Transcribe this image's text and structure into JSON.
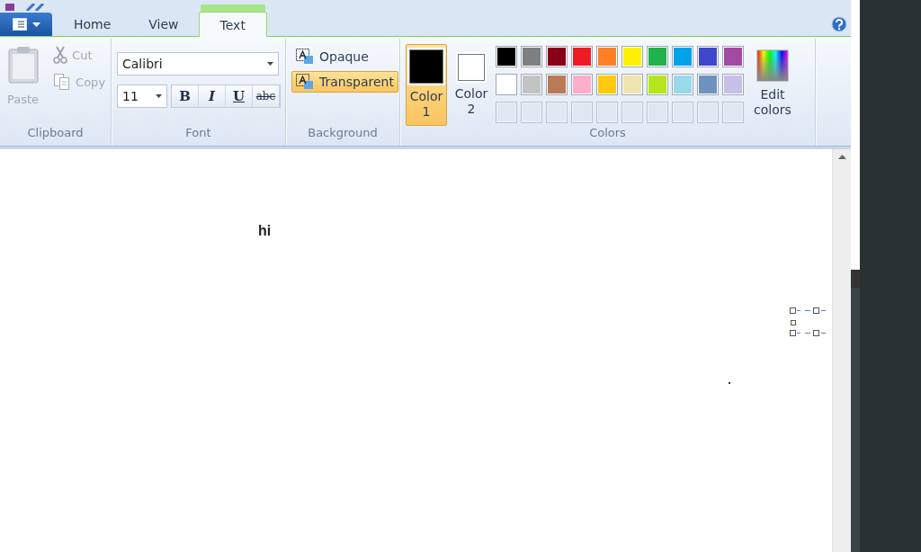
{
  "tabs": [
    {
      "label": "Home",
      "selected": false
    },
    {
      "label": "View",
      "selected": false
    },
    {
      "label": "Text",
      "selected": true
    }
  ],
  "clipboard": {
    "group_label": "Clipboard",
    "paste": {
      "label": "Paste",
      "disabled": true
    },
    "cut": {
      "label": "Cut",
      "disabled": true
    },
    "copy": {
      "label": "Copy",
      "disabled": true
    }
  },
  "font": {
    "group_label": "Font",
    "family": "Calibri",
    "size": "11",
    "styles": [
      {
        "kind": "bold",
        "label": "B"
      },
      {
        "kind": "italic",
        "label": "I"
      },
      {
        "kind": "underline",
        "label": "U"
      },
      {
        "kind": "strikethrough",
        "label": "abc"
      }
    ]
  },
  "background": {
    "group_label": "Background",
    "options": [
      {
        "label": "Opaque",
        "selected": false
      },
      {
        "label": "Transparent",
        "selected": true
      }
    ]
  },
  "colors": {
    "group_label": "Colors",
    "color1": {
      "label": "Color 1",
      "color": "#000000",
      "selected": true
    },
    "color2": {
      "label": "Color 2",
      "color": "#ffffff",
      "selected": false
    },
    "palette": [
      {
        "color": "#000000"
      },
      {
        "color": "#7f7f7f"
      },
      {
        "color": "#880015"
      },
      {
        "color": "#ed1c24"
      },
      {
        "color": "#ff7f27"
      },
      {
        "color": "#fff200"
      },
      {
        "color": "#22b14c"
      },
      {
        "color": "#00a2e8"
      },
      {
        "color": "#3f48cc"
      },
      {
        "color": "#a349a4"
      },
      {
        "color": "#ffffff"
      },
      {
        "color": "#c3c3c3"
      },
      {
        "color": "#b97a57"
      },
      {
        "color": "#ffaec9"
      },
      {
        "color": "#ffc90e"
      },
      {
        "color": "#efe4b0"
      },
      {
        "color": "#b5e61d"
      },
      {
        "color": "#99d9ea"
      },
      {
        "color": "#7092be"
      },
      {
        "color": "#c8bfe7"
      }
    ],
    "edit_colors": "Edit colors"
  },
  "canvas": {
    "text": "hi"
  }
}
